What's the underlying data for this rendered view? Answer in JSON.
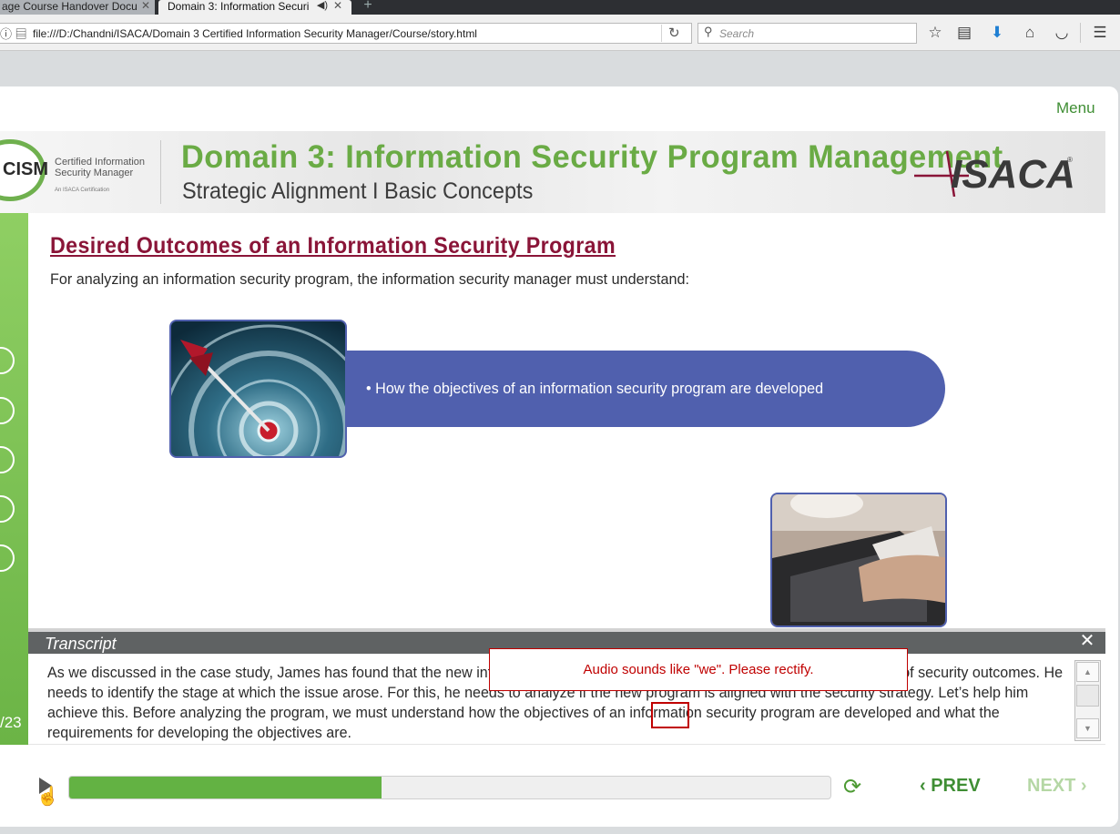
{
  "browser": {
    "tabs": [
      {
        "label": "age Course Handover Docu",
        "active": false
      },
      {
        "label": "Domain 3: Information Securi",
        "active": true
      }
    ],
    "url": "file:///D:/Chandni/ISACA/Domain 3 Certified Information Security Manager/Course/story.html",
    "search_placeholder": "Search",
    "toolbar_icons": [
      "star-icon",
      "reading-list-icon",
      "download-icon",
      "home-icon",
      "pocket-icon",
      "hamburger-menu-icon"
    ]
  },
  "player": {
    "menu_label": "Menu",
    "banner": {
      "cism_logo_text": "CISM",
      "cism_subtitle": "Certified Information Security Manager",
      "cism_tagline": "An ISACA Certification",
      "title": "Domain 3: Information Security Program Management",
      "subtitle": "Strategic Alignment I Basic Concepts",
      "isaca_logo": "ISACA"
    },
    "slide": {
      "title": "Desired Outcomes of an Information Security Program",
      "intro": "For analyzing an information security program, the information security manager must understand:",
      "bullet": "How the objectives of an information security program are developed"
    },
    "sidebar": {
      "icons": [
        "glossary-icon",
        "help-icon",
        "resources-icon",
        "layers-icon",
        "info-icon"
      ],
      "slide_count": "/23"
    },
    "transcript": {
      "title": "Transcript",
      "text": "As we discussed in the case study, James has found that the new information security program is not providing the acceptable level of security outcomes. He needs to identify the stage at which the issue arose. For this, he needs to analyze if the new program is aligned with the security strategy. Let’s help him achieve this. Before analyzing the program, we must understand how the objectives of an information security program are developed and what the requirements for developing the objectives are."
    },
    "review_comment": "Audio sounds like \"we\". Please rectify.",
    "controls": {
      "progress": 0.41,
      "prev_label": "PREV",
      "next_label": "NEXT",
      "next_enabled": false
    }
  },
  "colors": {
    "brand_green": "#6aab45",
    "title_maroon": "#8a1538",
    "bar_blue": "#5060ae",
    "comment_red": "#c00000"
  }
}
